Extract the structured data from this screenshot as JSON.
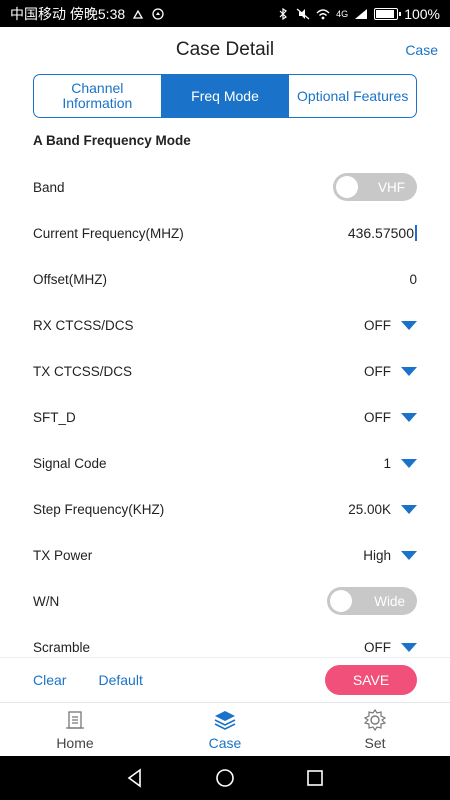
{
  "status_bar": {
    "carrier_time": "中国移动 傍晚5:38",
    "battery": "100%",
    "network": "4G"
  },
  "header": {
    "title": "Case Detail",
    "right_link": "Case"
  },
  "tabs": [
    {
      "label": "Channel Information",
      "active": false
    },
    {
      "label": "Freq Mode",
      "active": true
    },
    {
      "label": "Optional Features",
      "active": false
    }
  ],
  "section_title": "A Band Frequency Mode",
  "rows": {
    "band": {
      "label": "Band",
      "value": "VHF"
    },
    "current_frequency": {
      "label": "Current Frequency(MHZ)",
      "value": "436.57500"
    },
    "offset": {
      "label": "Offset(MHZ)",
      "value": "0"
    },
    "rx_ctcss": {
      "label": "RX CTCSS/DCS",
      "value": "OFF"
    },
    "tx_ctcss": {
      "label": "TX CTCSS/DCS",
      "value": "OFF"
    },
    "sft_d": {
      "label": "SFT_D",
      "value": "OFF"
    },
    "signal_code": {
      "label": "Signal Code",
      "value": "1"
    },
    "step_frequency": {
      "label": "Step Frequency(KHZ)",
      "value": "25.00K"
    },
    "tx_power": {
      "label": "TX Power",
      "value": "High"
    },
    "wn": {
      "label": "W/N",
      "value": "Wide"
    },
    "scramble": {
      "label": "Scramble",
      "value": "OFF"
    }
  },
  "actions": {
    "clear": "Clear",
    "default": "Default",
    "save": "SAVE"
  },
  "bottom_nav": [
    {
      "label": "Home",
      "icon": "home-icon",
      "active": false
    },
    {
      "label": "Case",
      "icon": "layers-icon",
      "active": true
    },
    {
      "label": "Set",
      "icon": "gear-icon",
      "active": false
    }
  ],
  "colors": {
    "accent": "#1a73c8",
    "save": "#f0507a",
    "toggle_off": "#c8c8c8"
  }
}
